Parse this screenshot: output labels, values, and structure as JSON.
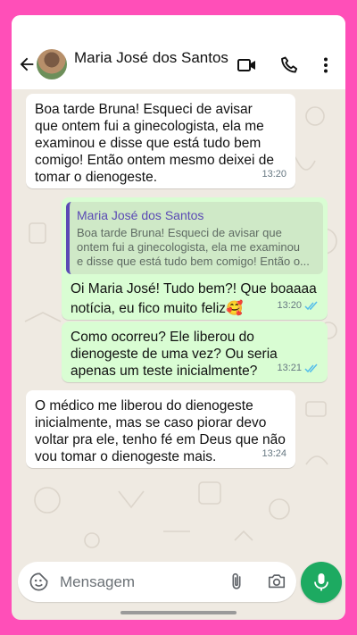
{
  "header": {
    "contact_name": "Maria José dos Santos"
  },
  "messages": [
    {
      "direction": "incoming",
      "text": "Boa tarde Bruna! Esqueci de avisar\nque ontem fui a ginecologista, ela me\nexaminou e disse que está tudo bem\ncomigo! Então ontem mesmo deixei de\ntomar o dienogeste.",
      "time": "13:20"
    },
    {
      "direction": "outgoing",
      "quote": {
        "author": "Maria José dos Santos",
        "text": "Boa tarde Bruna! Esqueci de avisar que\nontem fui a ginecologista, ela me examinou\ne disse que está tudo bem comigo! Então o..."
      },
      "text": "Oi Maria José! Tudo bem?! Que boaaaa\nnotícia, eu fico muito feliz🥰",
      "time": "13:20",
      "status": "read"
    },
    {
      "direction": "outgoing",
      "text": "Como ocorreu? Ele liberou do\ndienogeste de uma vez? Ou seria\napenas um teste inicialmente?",
      "time": "13:21",
      "status": "read"
    },
    {
      "direction": "incoming",
      "text": "O médico me liberou do dienogeste\ninicialmente, mas se caso piorar devo\nvoltar pra ele, tenho fé em Deus que não\nvou tomar o dienogeste mais.",
      "time": "13:24"
    }
  ],
  "composer": {
    "placeholder": "Mensagem"
  },
  "icons": {
    "back": "back-arrow-icon",
    "video": "video-call-icon",
    "call": "phone-call-icon",
    "menu": "more-vert-icon",
    "emoji": "sticker-emoji-icon",
    "attach": "paperclip-icon",
    "camera": "camera-icon",
    "mic": "microphone-icon",
    "read_ticks": "double-check-icon"
  },
  "colors": {
    "frame": "#ff4fb8",
    "chat_background": "#efeae2",
    "outgoing_bubble": "#d9fdd3",
    "incoming_bubble": "#ffffff",
    "read_ticks": "#53bdeb",
    "mic_button": "#1daa61",
    "quote_accent": "#5b4ab5"
  }
}
